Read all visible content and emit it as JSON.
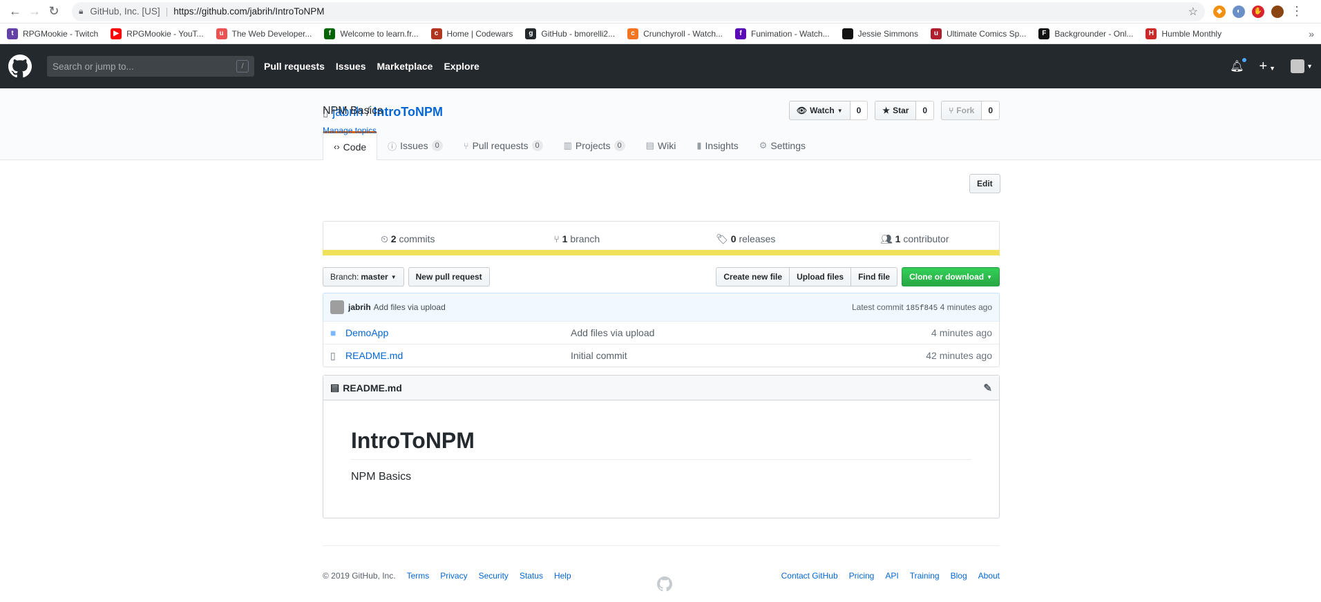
{
  "browser": {
    "site_identity": "GitHub, Inc. [US]",
    "url": "https://github.com/jabrih/IntroToNPM",
    "bookmarks": [
      {
        "label": "RPGMookie - Twitch",
        "color": "#6441a5",
        "glyph": "t"
      },
      {
        "label": "RPGMookie - YouT...",
        "color": "#ff0000",
        "glyph": "▶"
      },
      {
        "label": "The Web Developer...",
        "color": "#ec5252",
        "glyph": "u"
      },
      {
        "label": "Welcome to learn.fr...",
        "color": "#006400",
        "glyph": "f"
      },
      {
        "label": "Home | Codewars",
        "color": "#b1361e",
        "glyph": "c"
      },
      {
        "label": "GitHub - bmorelli2...",
        "color": "#24292e",
        "glyph": "g"
      },
      {
        "label": "Crunchyroll - Watch...",
        "color": "#f47521",
        "glyph": "c"
      },
      {
        "label": "Funimation - Watch...",
        "color": "#5b0bb5",
        "glyph": "f"
      },
      {
        "label": "Jessie Simmons",
        "color": "#111111",
        "glyph": ""
      },
      {
        "label": "Ultimate Comics Sp...",
        "color": "#b01e2e",
        "glyph": "u"
      },
      {
        "label": "Backgrounder - Onl...",
        "color": "#111111",
        "glyph": "F"
      },
      {
        "label": "Humble Monthly",
        "color": "#cc2929",
        "glyph": "H"
      }
    ]
  },
  "header": {
    "search_placeholder": "Search or jump to...",
    "search_shortcut": "/",
    "nav": [
      "Pull requests",
      "Issues",
      "Marketplace",
      "Explore"
    ]
  },
  "repo": {
    "owner": "jabrih",
    "name": "IntroToNPM",
    "watch_label": "Watch",
    "watch_count": "0",
    "star_label": "Star",
    "star_count": "0",
    "fork_label": "Fork",
    "fork_count": "0",
    "tabs": [
      {
        "label": "Code",
        "icon": "code-icon",
        "counter": ""
      },
      {
        "label": "Issues",
        "icon": "issue-icon",
        "counter": "0"
      },
      {
        "label": "Pull requests",
        "icon": "pr-icon",
        "counter": "0"
      },
      {
        "label": "Projects",
        "icon": "project-icon",
        "counter": "0"
      },
      {
        "label": "Wiki",
        "icon": "book-icon",
        "counter": ""
      },
      {
        "label": "Insights",
        "icon": "graph-icon",
        "counter": ""
      },
      {
        "label": "Settings",
        "icon": "gear-icon",
        "counter": ""
      }
    ],
    "description": "NPM Basics",
    "edit_label": "Edit",
    "manage_topics": "Manage topics",
    "stats": {
      "commits_num": "2",
      "commits_label": "commits",
      "branch_num": "1",
      "branch_label": "branch",
      "releases_num": "0",
      "releases_label": "releases",
      "contrib_num": "1",
      "contrib_label": "contributor"
    },
    "language_color": "#f1e05a",
    "branch_label": "Branch:",
    "branch_name": "master",
    "new_pr": "New pull request",
    "create_file": "Create new file",
    "upload_files": "Upload files",
    "find_file": "Find file",
    "clone": "Clone or download",
    "commit": {
      "author": "jabrih",
      "message": "Add files via upload",
      "latest_label": "Latest commit",
      "sha": "185f845",
      "age": "4 minutes ago"
    },
    "files": [
      {
        "name": "DemoApp",
        "type": "folder",
        "message": "Add files via upload",
        "age": "4 minutes ago"
      },
      {
        "name": "README.md",
        "type": "file",
        "message": "Initial commit",
        "age": "42 minutes ago"
      }
    ],
    "readme": {
      "filename": "README.md",
      "heading": "IntroToNPM",
      "body": "NPM Basics"
    }
  },
  "footer": {
    "copyright": "© 2019 GitHub, Inc.",
    "left_links": [
      "Terms",
      "Privacy",
      "Security",
      "Status",
      "Help"
    ],
    "right_links": [
      "Contact GitHub",
      "Pricing",
      "API",
      "Training",
      "Blog",
      "About"
    ]
  }
}
